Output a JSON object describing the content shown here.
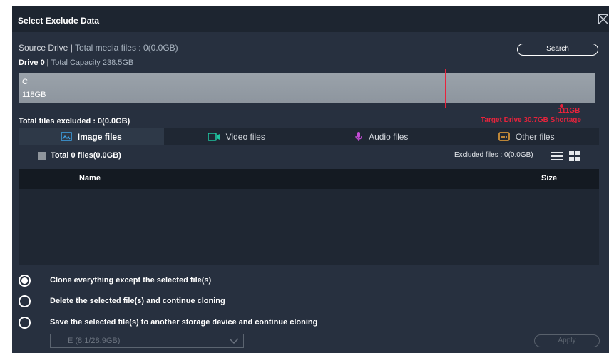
{
  "window": {
    "title": "Select Exclude Data"
  },
  "source": {
    "label": "Source Drive |",
    "media_files": "Total media files : 0(0.0GB)",
    "drive_name": "Drive 0 |",
    "capacity": "Total Capacity 238.5GB"
  },
  "search_label": "Search",
  "capacity_bar": {
    "partition_letter": "C",
    "partition_size": "118GB",
    "target_fill_fraction": 0.74,
    "target_size": "111GB",
    "shortage_text": "Target Drive 30.7GB Shortage"
  },
  "excluded_total": "Total files excluded : 0(0.0GB)",
  "tabs": [
    {
      "label": "Image files",
      "icon": "image-icon",
      "color": "#3fa4e8"
    },
    {
      "label": "Video files",
      "icon": "video-icon",
      "color": "#1fc3a0"
    },
    {
      "label": "Audio files",
      "icon": "microphone-icon",
      "color": "#c44bd6"
    },
    {
      "label": "Other files",
      "icon": "other-files-icon",
      "color": "#f0a53a"
    }
  ],
  "file_list": {
    "total_label": "Total 0 files(0.0GB)",
    "excluded_label": "Excluded files : 0(0.0GB)",
    "columns": {
      "name": "Name",
      "size": "Size"
    },
    "rows": []
  },
  "options": [
    {
      "label": "Clone everything except the selected file(s)",
      "checked": true
    },
    {
      "label": "Delete the selected file(s) and continue cloning",
      "checked": false
    },
    {
      "label": "Save the selected file(s) to another storage device and continue cloning",
      "checked": false
    }
  ],
  "destination": {
    "value": "E (8.1/28.9GB)"
  },
  "apply_label": "Apply",
  "colors": {
    "accent_red": "#e8233c",
    "background": "#27303f"
  }
}
